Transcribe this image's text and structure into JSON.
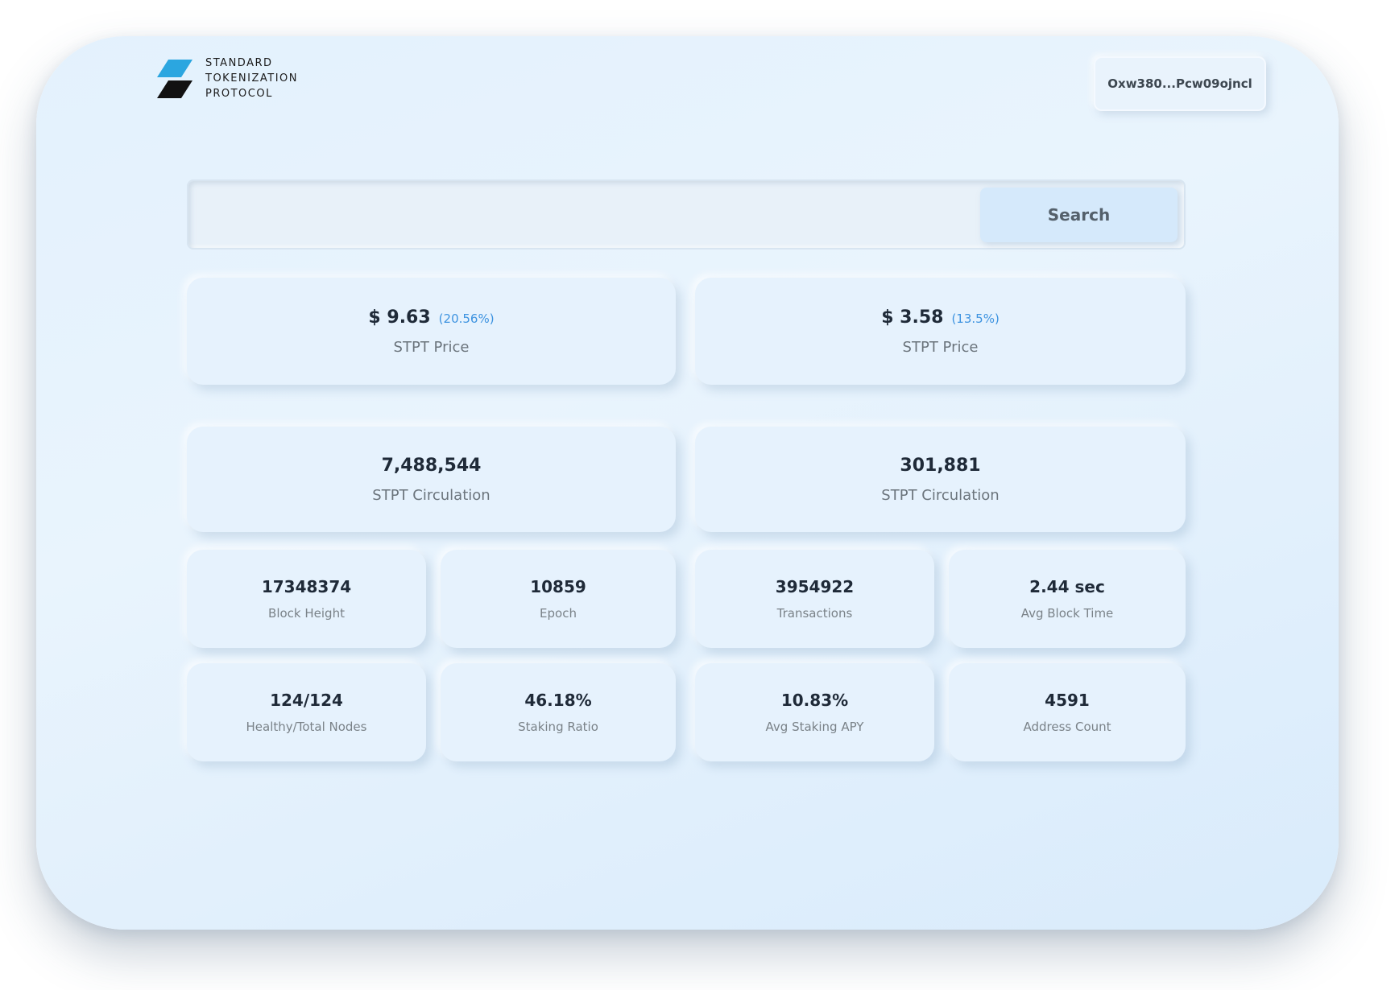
{
  "brand": {
    "lines": [
      "STANDARD",
      "TOKENIZATION",
      "PROTOCOL"
    ],
    "colors": {
      "top": "#2ba6e0",
      "bottom": "#111111"
    }
  },
  "wallet": {
    "address": "Oxw380...Pcw09ojncl"
  },
  "search": {
    "placeholder": "",
    "value": "",
    "button_label": "Search"
  },
  "price_cards": [
    {
      "value": "$ 9.63",
      "change": "(20.56%)",
      "label": "STPT Price"
    },
    {
      "value": "$ 3.58",
      "change": "(13.5%)",
      "label": "STPT Price"
    }
  ],
  "circulation_cards": [
    {
      "value": "7,488,544",
      "label": "STPT Circulation"
    },
    {
      "value": "301,881",
      "label": "STPT Circulation"
    }
  ],
  "stats_row1": [
    {
      "value": "17348374",
      "label": "Block Height"
    },
    {
      "value": "10859",
      "label": "Epoch"
    },
    {
      "value": "3954922",
      "label": "Transactions"
    },
    {
      "value": "2.44 sec",
      "label": "Avg Block Time"
    }
  ],
  "stats_row2": [
    {
      "value": "124/124",
      "label": "Healthy/Total Nodes"
    },
    {
      "value": "46.18%",
      "label": "Staking Ratio"
    },
    {
      "value": "10.83%",
      "label": "Avg Staking APY"
    },
    {
      "value": "4591",
      "label": "Address Count"
    }
  ],
  "colors": {
    "accent": "#3d93e0",
    "value_text": "#1f2a38",
    "label_text": "#6b747c",
    "background": "#e6f2fd"
  }
}
